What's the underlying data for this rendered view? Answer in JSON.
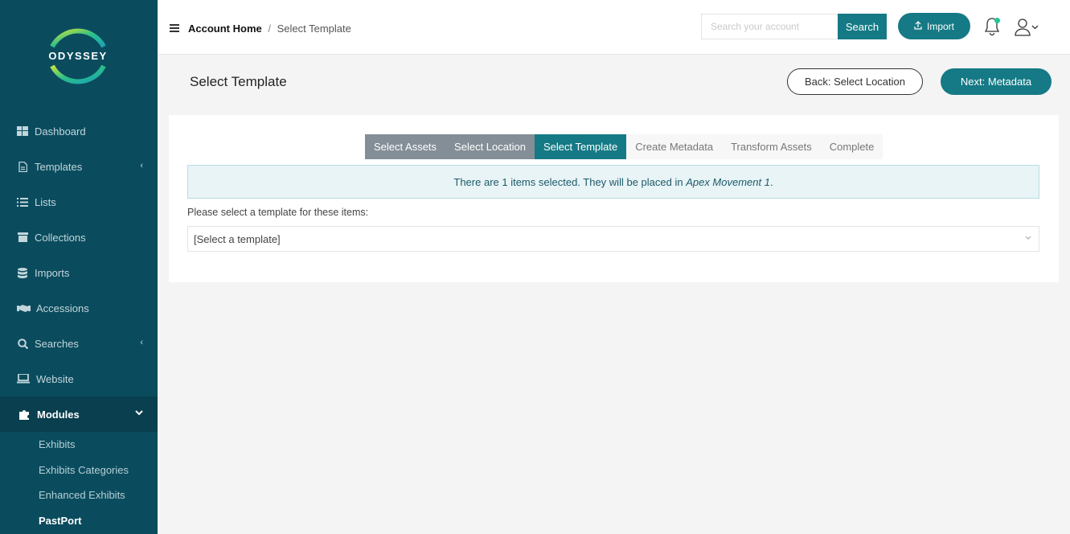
{
  "brand": {
    "logo_text": "ODYSSEY",
    "accent": "#157a85",
    "sidebar_bg": "#0a4c5e"
  },
  "sidebar": {
    "items": [
      {
        "label": "Dashboard",
        "icon": "dashboard-icon"
      },
      {
        "label": "Templates",
        "icon": "file-icon",
        "chevron": "‹"
      },
      {
        "label": "Lists",
        "icon": "list-icon"
      },
      {
        "label": "Collections",
        "icon": "archive-icon"
      },
      {
        "label": "Imports",
        "icon": "database-icon"
      },
      {
        "label": "Accessions",
        "icon": "handshake-icon"
      },
      {
        "label": "Searches",
        "icon": "search-icon",
        "chevron": "‹"
      },
      {
        "label": "Website",
        "icon": "laptop-icon"
      },
      {
        "label": "Modules",
        "icon": "puzzle-icon",
        "chevron": "⌄"
      }
    ],
    "modules_sub": [
      "Exhibits",
      "Exhibits Categories",
      "Enhanced Exhibits",
      "PastPort"
    ]
  },
  "topbar": {
    "breadcrumb_home": "Account Home",
    "breadcrumb_sep": "/",
    "breadcrumb_current": "Select Template",
    "search_placeholder": "Search your account",
    "search_label": "Search",
    "import_label": "Import"
  },
  "page": {
    "title": "Select Template",
    "back_label": "Back: Select Location",
    "next_label": "Next: Metadata"
  },
  "wizard": {
    "steps": [
      {
        "label": "Select Assets",
        "state": "done"
      },
      {
        "label": "Select Location",
        "state": "done"
      },
      {
        "label": "Select Template",
        "state": "current"
      },
      {
        "label": "Create Metadata",
        "state": "future"
      },
      {
        "label": "Transform Assets",
        "state": "future"
      },
      {
        "label": "Complete",
        "state": "future"
      }
    ],
    "info_prefix": "There are 1 items selected. They will be placed in ",
    "info_location": "Apex Movement 1",
    "info_suffix": ".",
    "prompt": "Please select a template for these items:",
    "select_value": "[Select a template]"
  }
}
